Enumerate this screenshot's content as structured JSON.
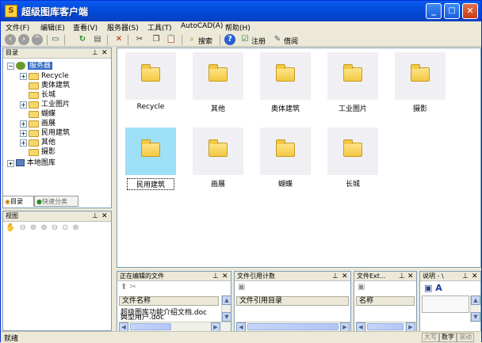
{
  "window": {
    "title": "超级图库客户端",
    "controls": {
      "minimize": "_",
      "maximize": "□",
      "close": "✕"
    }
  },
  "menu": [
    "文件(F)",
    "编辑(E)",
    "查看(V)",
    "服务器(S)",
    "工具(T)",
    "AutoCAD(A)",
    "帮助(H)"
  ],
  "toolbar": {
    "search_label": "搜索",
    "register_label": "注册",
    "feedback_label": "借阅"
  },
  "directory_panel": {
    "title": "目录",
    "root": "服务器",
    "items": [
      "Recycle",
      "奥体建筑",
      "长城",
      "工业图片",
      "蝴蝶",
      "画展",
      "民用建筑",
      "其他",
      "摄影"
    ],
    "local": "本地图库",
    "tabs": [
      "目录",
      "快速分类"
    ]
  },
  "view_panel": {
    "title": "视图"
  },
  "thumbnails": [
    {
      "label": "Recycle"
    },
    {
      "label": "其他"
    },
    {
      "label": "奥体建筑"
    },
    {
      "label": "工业图片"
    },
    {
      "label": "摄影"
    },
    {
      "label": "民用建筑",
      "selected": true
    },
    {
      "label": "画展"
    },
    {
      "label": "蝴蝶"
    },
    {
      "label": "长城"
    }
  ],
  "editing_panel": {
    "title": "正在编辑的文件",
    "column": "文件名称",
    "rows": [
      "超级图库功能介绍文档.doc",
      "典型用户.doc"
    ]
  },
  "ref_count_panel": {
    "title": "文件引用计数",
    "column": "文件引用目录"
  },
  "file_ext_panel": {
    "title": "文件Ext...",
    "column": "名称"
  },
  "desc_panel": {
    "title": "说明 - \\"
  },
  "status": {
    "text": "就绪",
    "cells": [
      "大写",
      "数字",
      "滚动"
    ]
  },
  "colors": {
    "titlebar": "#0550e0",
    "selected_tile": "#9ee0f8",
    "folder": "#f4c842"
  }
}
